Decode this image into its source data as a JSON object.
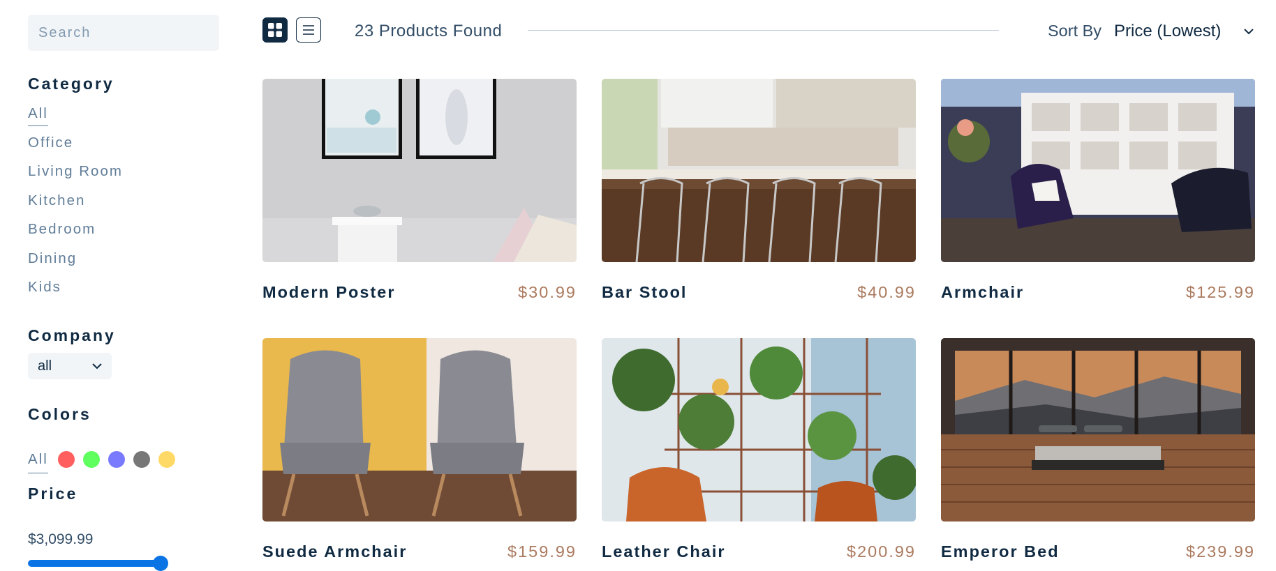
{
  "search": {
    "placeholder": "Search"
  },
  "filters": {
    "category_title": "Category",
    "categories": [
      "All",
      "Office",
      "Living Room",
      "Kitchen",
      "Bedroom",
      "Dining",
      "Kids"
    ],
    "company_title": "Company",
    "company_selected": "all",
    "colors_title": "Colors",
    "colors_all": "All",
    "colors": [
      "#ff5f5f",
      "#5fff5f",
      "#7a7aff",
      "#777777",
      "#ffd966"
    ],
    "price_title": "Price",
    "price_value": "$3,099.99",
    "price_slider_fraction": 1.0
  },
  "toolbar": {
    "products_found": "23 Products Found",
    "sort_label": "Sort By",
    "sort_selected": "Price (Lowest)"
  },
  "products": [
    {
      "name": "Modern Poster",
      "price": "$30.99"
    },
    {
      "name": "Bar Stool",
      "price": "$40.99"
    },
    {
      "name": "Armchair",
      "price": "$125.99"
    },
    {
      "name": "Suede Armchair",
      "price": "$159.99"
    },
    {
      "name": "Leather Chair",
      "price": "$200.99"
    },
    {
      "name": "Emperor Bed",
      "price": "$239.99"
    }
  ],
  "colors": {
    "primary": "#102a42",
    "accent": "#ab7a5f",
    "muted": "#617d98",
    "slider": "#0b74e5"
  }
}
